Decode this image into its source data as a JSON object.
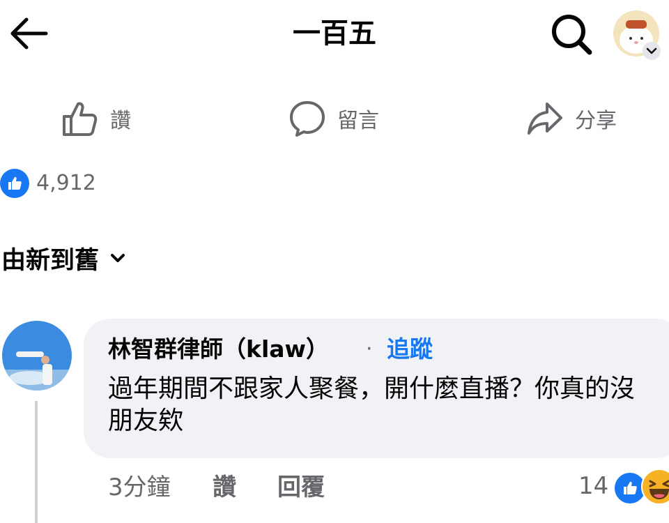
{
  "header": {
    "title": "一百五",
    "back_icon": "arrow-left-icon",
    "search_icon": "search-icon"
  },
  "actions": [
    {
      "label": "讚",
      "icon": "thumbs-up-outline-icon"
    },
    {
      "label": "留言",
      "icon": "comment-bubble-icon"
    },
    {
      "label": "分享",
      "icon": "share-arrow-icon"
    }
  ],
  "reactions": {
    "count": "4,912",
    "icon": "like-reaction-icon"
  },
  "sort": {
    "label": "由新到舊",
    "icon": "chevron-down-icon"
  },
  "comment": {
    "author": "林智群律師（klaw）",
    "separator": "·",
    "follow": "追蹤",
    "text": "過年期間不跟家人聚餐，開什麼直播？你真的沒朋友欸",
    "time": "3分鐘",
    "like": "讚",
    "reply": "回覆",
    "reaction_count": "14",
    "reaction_icons": [
      "like-reaction-icon",
      "haha-reaction-icon"
    ]
  },
  "colors": {
    "brand_blue": "#1877f2",
    "secondary_text": "#65676b",
    "bubble_bg": "#f0f2f5"
  }
}
